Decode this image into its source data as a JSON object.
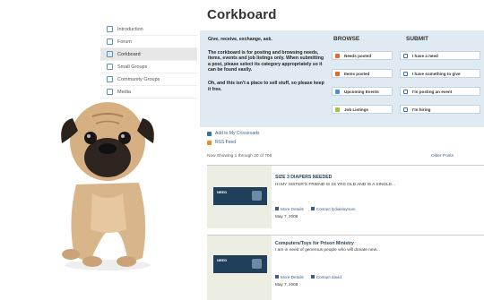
{
  "page": {
    "title": "Corkboard"
  },
  "sidebar": {
    "items": [
      {
        "label": "Introduction",
        "active": false
      },
      {
        "label": "Forum",
        "active": false
      },
      {
        "label": "Corkboard",
        "active": true
      },
      {
        "label": "Small Groups",
        "active": false
      },
      {
        "label": "Community Groups",
        "active": false
      },
      {
        "label": "Media",
        "active": false
      }
    ]
  },
  "intro": {
    "p1": "Give, receive, exchange, ask.",
    "p2": "The corkboard is for posting and browsing needs, items, events and job listings only. When submitting a post, please select its category appropriately so it can be found easily.",
    "p3": "Oh, and this isn't a place to sell stuff, so please keep it free."
  },
  "browse": {
    "heading": "BROWSE",
    "options": [
      {
        "label": "Needs posted",
        "color": "#e06a2a"
      },
      {
        "label": "Items posted",
        "color": "#e06a2a"
      },
      {
        "label": "Upcoming Events",
        "color": "#4a8fd0"
      },
      {
        "label": "Job Listings",
        "color": "#9fc63a"
      }
    ]
  },
  "submit": {
    "heading": "SUBMIT",
    "options": [
      {
        "label": "I have a need"
      },
      {
        "label": "I have something to give"
      },
      {
        "label": "I'm posting an event"
      },
      {
        "label": "I'm hiring"
      }
    ]
  },
  "links": {
    "add": "Add to My Crossroads",
    "rss": "RSS Feed"
  },
  "showing": {
    "text": "Now Showing 1 through 20 of 708",
    "older": "Older Posts"
  },
  "listings": [
    {
      "tag": "NEED",
      "title": "SIZE 3 DIAPERS NEEDED",
      "body": "HI MY SISTER'S FRIEND IS 18 YRS OLD AND IS A SINGLE...",
      "more": "More Details",
      "contact": "Contact lydiaklayman",
      "date": "May 7, 2008"
    },
    {
      "tag": "NEED",
      "title": "Computers/Toys for Prison Ministry",
      "body": "I am in need of generous people who will donate new...",
      "more": "More Details",
      "contact": "Contact david",
      "date": "May 7, 2008"
    }
  ]
}
